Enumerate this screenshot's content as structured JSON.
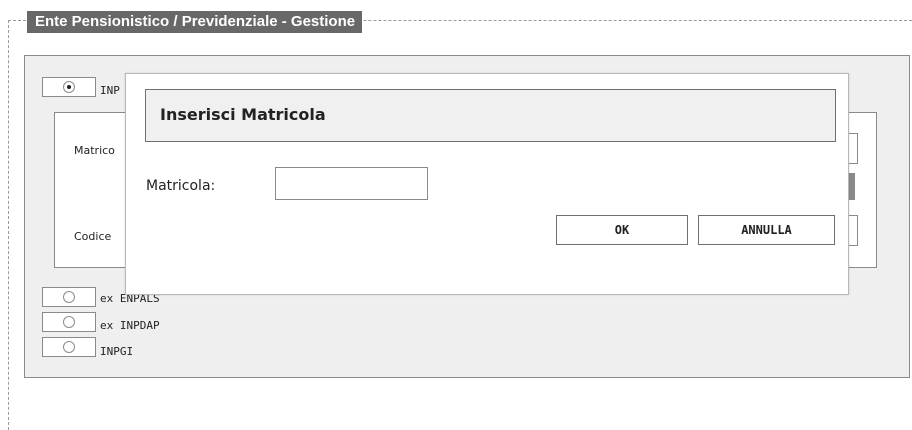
{
  "section": {
    "legend": "Ente Pensionistico / Previdenziale - Gestione"
  },
  "options": [
    {
      "label": "INP",
      "checked": true
    },
    {
      "label": "ex ENPALS",
      "checked": false
    },
    {
      "label": "ex INPDAP",
      "checked": false
    },
    {
      "label": "INPGI",
      "checked": false
    }
  ],
  "background_form": {
    "matricola_label": "Matrico",
    "codice_label": "Codice"
  },
  "dialog": {
    "title": "Inserisci Matricola",
    "field_label": "Matricola:",
    "field_value": "",
    "ok_label": "OK",
    "cancel_label": "ANNULLA"
  }
}
